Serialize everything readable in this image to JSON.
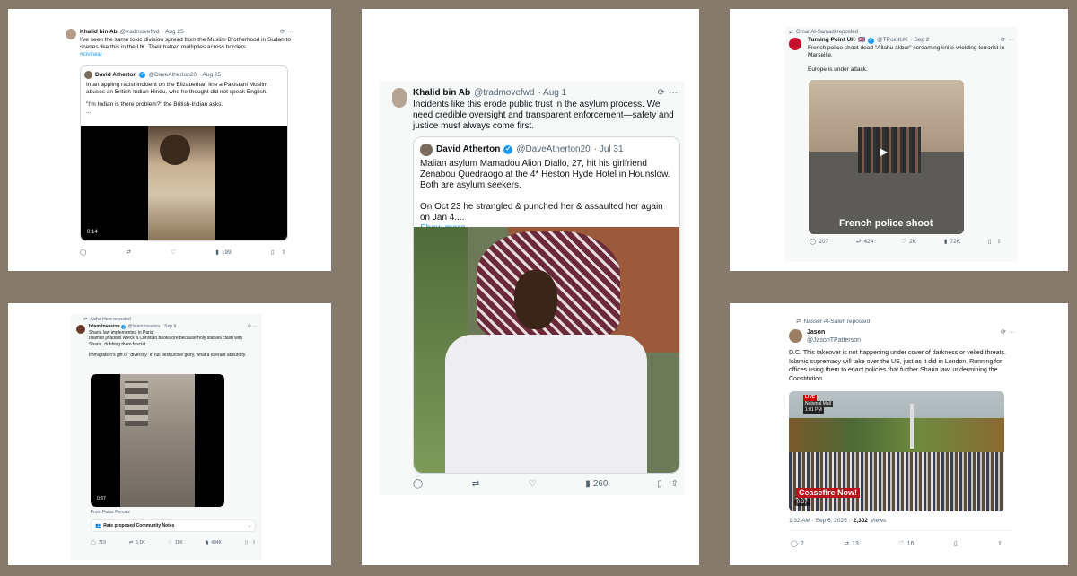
{
  "tweet1": {
    "author": "Khalid bin Ab",
    "handle": "@tradmovefwd",
    "date": "· Aug 25",
    "text": "I've seen the same toxic division spread from the Muslim Brotherhood in Sudan to scenes like this in the UK. Their hatred multiplies across borders.",
    "hashtag": "#civilwar",
    "quote": {
      "author": "David Atherton",
      "handle": "@DaveAtherton20",
      "date": "· Aug 25",
      "text1": "In an appling racist incident on the Elizabethan line a Pakistani Muslim abuses an British-Indian Hindu, who he thought did not speak English.",
      "text2": "\"I'm Indian is there problem?\" the British-Indian asks.",
      "ellipsis": "...",
      "duration": "0:14"
    },
    "views": "199"
  },
  "tweet2": {
    "author": "Khalid bin Ab",
    "handle": "@tradmovefwd",
    "date": "· Aug 1",
    "text": "Incidents like this erode public trust in the asylum process. We need credible oversight and transparent enforcement—safety and justice must always come first.",
    "quote": {
      "author": "David Atherton",
      "handle": "@DaveAtherton20",
      "date": "· Jul 31",
      "text1": "Malian asylum Mamadou Alion Diallo, 27, hit his girlfriend Zenabou Quedraogo at the 4* Heston Hyde Hotel in Hounslow. Both are asylum seekers.",
      "text2": "On Oct 23 he strangled & punched her & assaulted her again on Jan 4....",
      "show_more": "Show more"
    },
    "views": "260"
  },
  "tweet3": {
    "repost": "Omar Al-Samadi reposted",
    "author": "Turning Point UK",
    "flag": "🇬🇧",
    "handle": "@TPointUK",
    "date": "· Sep 2",
    "text1": "French police shoot dead \"Allahu akbar\" screaming knife-wielding terrorist in Marseille.",
    "text2": "Europe is under attack.",
    "video_caption": "French police shoot",
    "stats": {
      "replies": "207",
      "reposts": "424",
      "likes": "2K",
      "views": "72K"
    }
  },
  "tweet4": {
    "repost": "Aisha Here reposted",
    "author": "Islam Invasion",
    "handle": "@IslamInvasion",
    "date": "· Sep 9",
    "text1": "Sharia law implemented in Paris:",
    "text2": "Islamist jihadists wreck a Christian bookstore because holy statues clash with Sharia, dubbing them fascist.",
    "text3": "Immigration's gift of \"diversity\" in full destructive glory, what a tolerant absurdity.",
    "duration": "0:37",
    "from": "From Faraz Pervaiz",
    "notes_label": "Rate proposed Community Notes",
    "stats": {
      "replies": "719",
      "reposts": "5.1K",
      "likes": "15K",
      "views": "494K"
    }
  },
  "tweet5": {
    "repost": "Nasser Al-Saleh reposted",
    "author": "Jason",
    "handle": "@JasonTPatterson",
    "text": "D.C. This takeover is not happening under cover of darkness or veiled threats. Islamic supremacy will take over the US, just as it did in London. Running for offices using them to enact policies that further Sharia law, undermining the Constitution.",
    "live": "LIVE",
    "channel": "National Mall",
    "clock": "1:01 PM",
    "banner": "Ceasefire Now!",
    "duration": "0:27",
    "meta_time": "1:32 AM · Sep 6, 2025 ·",
    "meta_views": "2,302",
    "meta_views_label": "Views",
    "stats": {
      "replies": "2",
      "reposts": "13",
      "likes": "16"
    }
  },
  "icons": [
    "reply-icon",
    "repost-icon",
    "like-icon",
    "views-icon",
    "bookmark-icon",
    "share-icon",
    "grok-icon",
    "more-icon",
    "play-icon"
  ]
}
